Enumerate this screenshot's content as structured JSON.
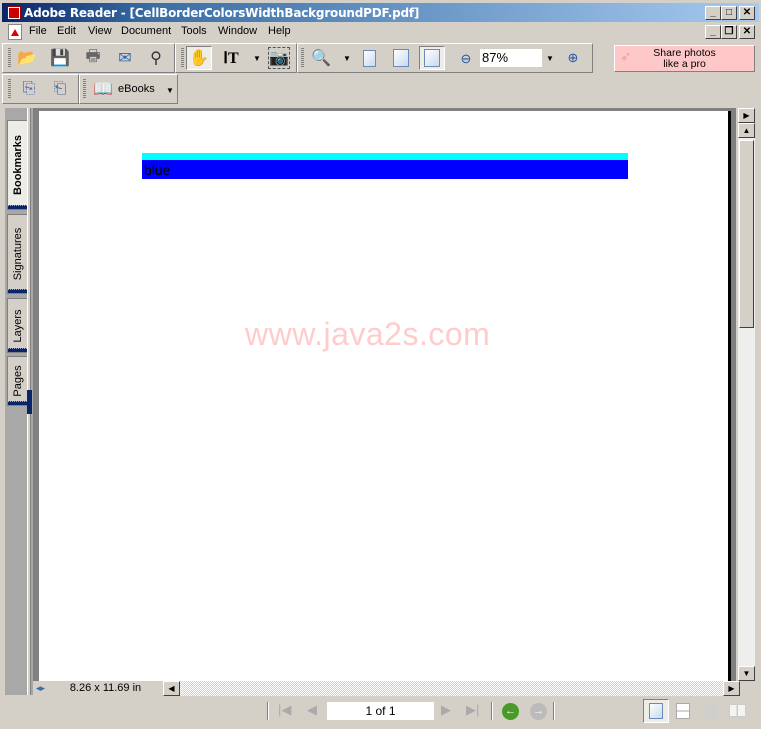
{
  "window": {
    "title": "Adobe Reader - [CellBorderColorsWidthBackgroundPDF.pdf]",
    "controls": {
      "minimize": "_",
      "maximize": "□",
      "close": "✕",
      "restore": "❐"
    }
  },
  "menu": {
    "items": [
      "File",
      "Edit",
      "View",
      "Document",
      "Tools",
      "Window",
      "Help"
    ]
  },
  "toolbar": {
    "zoom_value": "87%",
    "ebooks_label": "eBooks",
    "ad_line1": "Share photos",
    "ad_line2": "like a pro",
    "icons": [
      "open-icon",
      "save-icon",
      "print-icon",
      "email-icon",
      "search-icon",
      "hand-tool-icon",
      "select-text-icon",
      "snapshot-icon",
      "zoom-in-tool-icon",
      "actual-size-icon",
      "fit-page-icon",
      "fit-width-icon",
      "zoom-out-icon",
      "zoom-in-icon"
    ]
  },
  "sidebar": {
    "tabs": [
      "Bookmarks",
      "Signatures",
      "Layers",
      "Pages"
    ]
  },
  "document": {
    "cell_text": "blue",
    "cell_background": "#0000ff",
    "cell_border_top": "#00ffff",
    "watermark": "www.java2s.com",
    "watermark_color": "#ffcccc"
  },
  "statusbar": {
    "page_size": "8.26 x 11.69 in",
    "page_indicator": "1 of 1"
  }
}
